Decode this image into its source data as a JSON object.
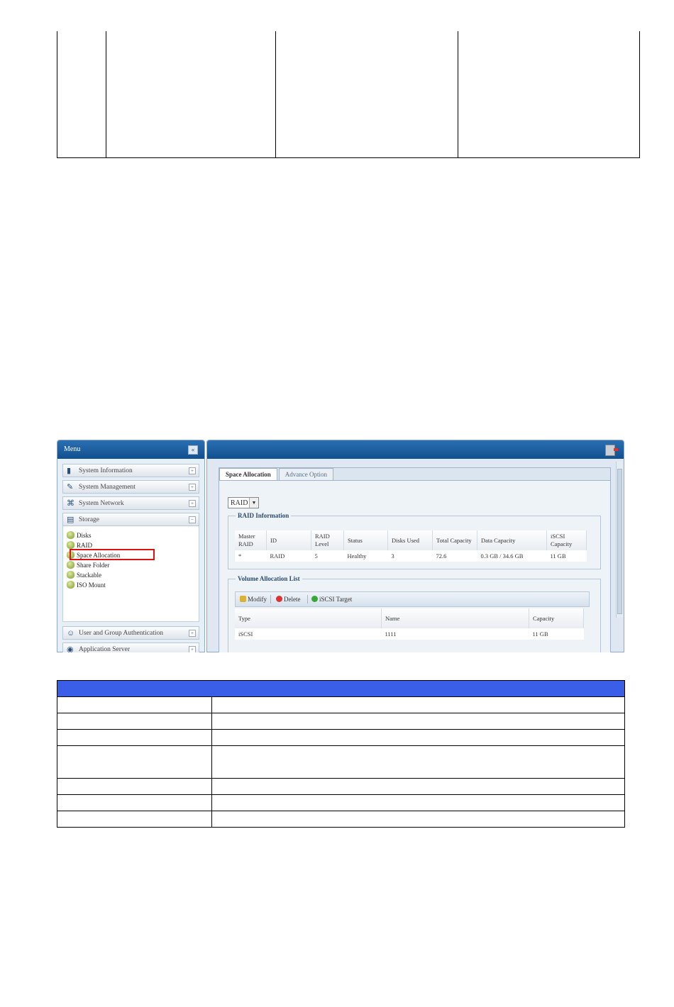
{
  "screenshot": {
    "menu": {
      "title": "Menu",
      "collapse_glyph": "«",
      "items": [
        {
          "label": "System Information",
          "icon": "info-book-icon"
        },
        {
          "label": "System Management",
          "icon": "wrench-icon"
        },
        {
          "label": "System Network",
          "icon": "network-icon"
        },
        {
          "label": "Storage",
          "icon": "storage-icon"
        },
        {
          "label": "User and Group Authentication",
          "icon": "users-icon"
        },
        {
          "label": "Application Server",
          "icon": "server-icon"
        }
      ],
      "storage_subitems": [
        "Disks",
        "RAID",
        "Space Allocation",
        "Share Folder",
        "Stackable",
        "ISO Mount"
      ]
    },
    "tabs": [
      "Space Allocation",
      "Advance Option"
    ],
    "raid_select": "RAID",
    "raid_info": {
      "legend": "RAID Information",
      "headers": [
        "Master RAID",
        "ID",
        "RAID Level",
        "Status",
        "Disks Used",
        "Total Capacity",
        "Data Capacity",
        "iSCSI Capacity"
      ],
      "rows": [
        [
          "*",
          "RAID",
          "5",
          "Healthy",
          "3",
          "72.6",
          "0.3 GB / 34.6 GB",
          "11 GB"
        ]
      ]
    },
    "volume_list": {
      "legend": "Volume Allocation List",
      "toolbar": [
        "Modify",
        "Delete",
        "iSCSI Target"
      ],
      "headers": [
        "Type",
        "Name",
        "Capacity"
      ],
      "rows": [
        [
          "iSCSI",
          "1111",
          "11 GB"
        ]
      ]
    },
    "colors": {
      "header_blue": "#12508f",
      "highlight_red": "#dd1111",
      "table_header_blue": "#3b5ee8"
    }
  }
}
